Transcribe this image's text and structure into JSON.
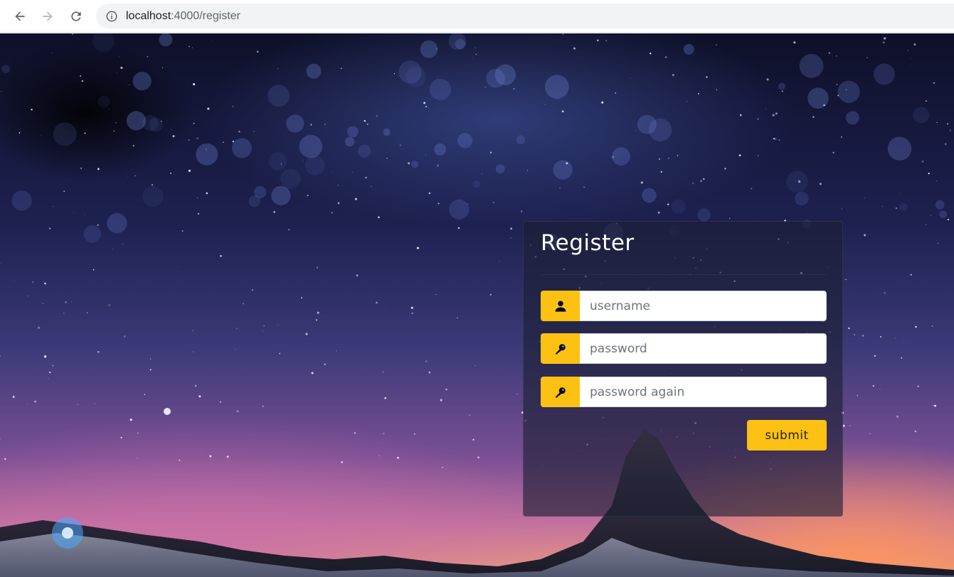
{
  "browser": {
    "url_host": "localhost",
    "url_path": ":4000/register"
  },
  "icons": {
    "back": "arrow-left-icon",
    "forward": "arrow-right-icon",
    "reload": "reload-icon",
    "site_info": "info-icon",
    "username": "user-icon",
    "password": "key-icon",
    "password_again": "key-icon"
  },
  "colors": {
    "accent": "#fdc113",
    "panel_bg": "rgba(28,30,50,0.62)",
    "title_text": "#ffffff"
  },
  "register": {
    "title": "Register",
    "username_placeholder": "username",
    "password_placeholder": "password",
    "password_again_placeholder": "password again",
    "submit_label": "submit"
  }
}
